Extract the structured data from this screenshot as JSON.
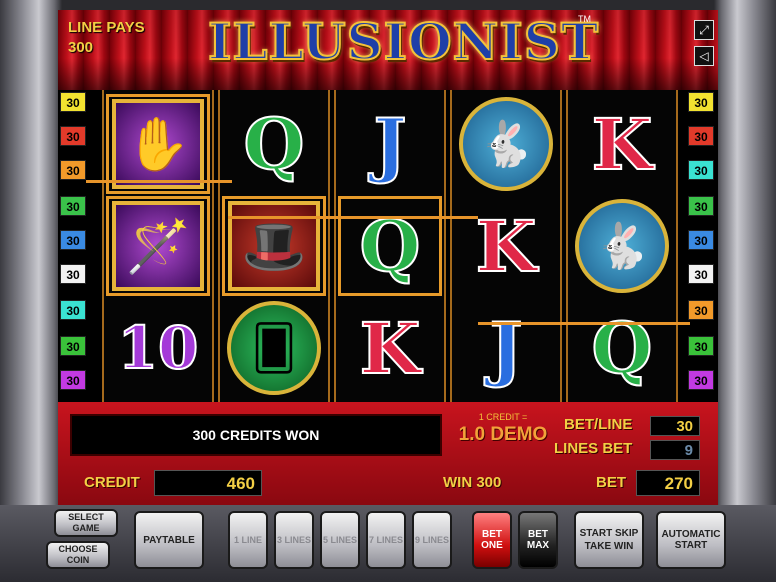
{
  "header": {
    "line_pays_label": "LINE PAYS",
    "line_pays_value": "300",
    "logo_text": "ILLUSIONIST",
    "trademark": "TM",
    "fullscreen_icon": "fullscreen-icon",
    "sound_icon": "speaker-icon"
  },
  "left_line_numbers": [
    {
      "label": "30",
      "color": "#f2e230"
    },
    {
      "label": "30",
      "color": "#e23a2a"
    },
    {
      "label": "30",
      "color": "#f29a2a"
    },
    {
      "label": "30",
      "color": "#3ac24a"
    },
    {
      "label": "30",
      "color": "#3a8ae2"
    },
    {
      "label": "30",
      "color": "#f2f2f2"
    },
    {
      "label": "30",
      "color": "#3ae2d2"
    },
    {
      "label": "30",
      "color": "#3ac23a"
    },
    {
      "label": "30",
      "color": "#c23ae2"
    }
  ],
  "right_line_numbers": [
    {
      "label": "30",
      "color": "#f2e230"
    },
    {
      "label": "30",
      "color": "#e23a2a"
    },
    {
      "label": "30",
      "color": "#3ae2d2"
    },
    {
      "label": "30",
      "color": "#3ac24a"
    },
    {
      "label": "30",
      "color": "#3a8ae2"
    },
    {
      "label": "30",
      "color": "#f2f2f2"
    },
    {
      "label": "30",
      "color": "#f29a2a"
    },
    {
      "label": "30",
      "color": "#3ac23a"
    },
    {
      "label": "30",
      "color": "#c23ae2"
    }
  ],
  "reels": [
    [
      {
        "symbol": "magic-gloves",
        "highlight": true
      },
      {
        "symbol": "magic-wand-hands",
        "highlight": true
      },
      {
        "symbol": "10",
        "color": "#a43ad8"
      }
    ],
    [
      {
        "symbol": "Q",
        "color": "#28b048"
      },
      {
        "symbol": "magician",
        "highlight": true
      },
      {
        "symbol": "cards-hand"
      }
    ],
    [
      {
        "symbol": "J",
        "color": "#2a6ee0"
      },
      {
        "symbol": "Q",
        "color": "#28b048",
        "highlight": true
      },
      {
        "symbol": "K",
        "color": "#e02848"
      }
    ],
    [
      {
        "symbol": "rabbit-hat"
      },
      {
        "symbol": "K",
        "color": "#e02848"
      },
      {
        "symbol": "J",
        "color": "#2a6ee0"
      }
    ],
    [
      {
        "symbol": "K",
        "color": "#e02848"
      },
      {
        "symbol": "rabbit-hat"
      },
      {
        "symbol": "Q",
        "color": "#28b048"
      }
    ]
  ],
  "panel": {
    "message": "300 CREDITS WON",
    "credit_rate": "1 CREDIT =",
    "demo_label": "1.0 DEMO",
    "bet_line_label": "BET/LINE",
    "bet_line_value": "30",
    "lines_bet_label": "LINES BET",
    "lines_bet_value": "9",
    "credit_label": "CREDIT",
    "credit_value": "460",
    "win_label": "WIN 300",
    "bet_label": "BET",
    "bet_value": "270"
  },
  "buttons": {
    "select_game": "SELECT GAME",
    "choose_coin": "CHOOSE COIN",
    "paytable": "PAYTABLE",
    "line1": "1 LINE",
    "line3": "3 LINES",
    "line5": "5 LINES",
    "line7": "7 LINES",
    "line9": "9 LINES",
    "bet_one": "BET ONE",
    "bet_max": "BET MAX",
    "start_skip": "START SKIP TAKE WIN",
    "auto_start": "AUTOMATIC START"
  },
  "colors": {
    "accent_gold": "#f3cf45",
    "panel_red": "#c8141e",
    "payline_orange": "#e7942a"
  }
}
